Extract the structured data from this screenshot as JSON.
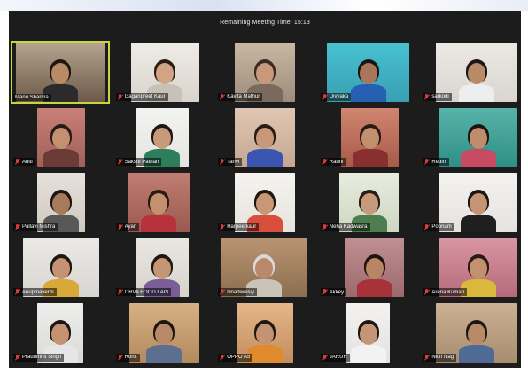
{
  "meeting": {
    "timer_text": "Remaining Meeting Time: 15:13"
  },
  "participants": [
    {
      "name": "Manu Sharma",
      "muted": false,
      "active": true,
      "bg": "#6d5a4a",
      "wall": "#b5a48f",
      "skin": "#b98a66",
      "hair": "#1e1612",
      "shirt": "#2b2b2b"
    },
    {
      "name": "Gaganpreet Kaur",
      "muted": true,
      "active": false,
      "bg": "#d9d3cc",
      "wall": "#efece7",
      "skin": "#d2a486",
      "hair": "#2a1c15",
      "shirt": "#c9c1b6"
    },
    {
      "name": "Kavita Mathur",
      "muted": true,
      "active": false,
      "bg": "#9c8c7a",
      "wall": "#c9b9a3",
      "skin": "#c8997a",
      "hair": "#3a2a22",
      "shirt": "#7a6a5e"
    },
    {
      "name": "Divyaka",
      "muted": true,
      "active": false,
      "bg": "#3a9fb3",
      "wall": "#48c1d1",
      "skin": "#a8765a",
      "hair": "#1c1410",
      "shirt": "#2660b3"
    },
    {
      "name": "sarkodi",
      "muted": true,
      "active": false,
      "bg": "#d9d5d0",
      "wall": "#ece9e4",
      "skin": "#b98a66",
      "hair": "#1e1612",
      "shirt": "#eeeeee"
    },
    {
      "name": "Aditi",
      "muted": true,
      "active": false,
      "bg": "#a0615a",
      "wall": "#c97f76",
      "skin": "#c39070",
      "hair": "#2a1a14",
      "shirt": "#6b3b38"
    },
    {
      "name": "Sakshi Pathan",
      "muted": true,
      "active": false,
      "bg": "#e4e4e0",
      "wall": "#f3f3f1",
      "skin": "#c79a7c",
      "hair": "#22170f",
      "shirt": "#2e7d5b"
    },
    {
      "name": "Tanvi",
      "muted": true,
      "active": false,
      "bg": "#c6a791",
      "wall": "#e0c7b3",
      "skin": "#c7987a",
      "hair": "#2a1c15",
      "shirt": "#3a56b0"
    },
    {
      "name": "Radni",
      "muted": true,
      "active": false,
      "bg": "#a85a4a",
      "wall": "#cf8570",
      "skin": "#c28f6f",
      "hair": "#2b1a12",
      "shirt": "#8a2f2f"
    },
    {
      "name": "Redini",
      "muted": true,
      "active": false,
      "bg": "#2f8f86",
      "wall": "#57b3a8",
      "skin": "#bf8c6c",
      "hair": "#1e1410",
      "shirt": "#c94a63"
    },
    {
      "name": "Pallavi Mishra",
      "muted": true,
      "active": false,
      "bg": "#cfc8c0",
      "wall": "#e6e1db",
      "skin": "#a87a5c",
      "hair": "#1e1612",
      "shirt": "#585858"
    },
    {
      "name": "Ayan",
      "muted": true,
      "active": false,
      "bg": "#9a5850",
      "wall": "#c07e72",
      "skin": "#c39070",
      "hair": "#2a1a14",
      "shirt": "#b8323c"
    },
    {
      "name": "Harpeetkaur",
      "muted": true,
      "active": false,
      "bg": "#e7e4df",
      "wall": "#f5f3ef",
      "skin": "#c79877",
      "hair": "#22170f",
      "shirt": "#d94f3d"
    },
    {
      "name": "Neha Kadwasra",
      "muted": true,
      "active": false,
      "bg": "#cfd6c2",
      "wall": "#e7ecde",
      "skin": "#c79a7c",
      "hair": "#2a1c15",
      "shirt": "#4d7f4e"
    },
    {
      "name": "Poonam",
      "muted": true,
      "active": false,
      "bg": "#e5e2df",
      "wall": "#f4f2ef",
      "skin": "#c49474",
      "hair": "#1e140f",
      "shirt": "#1f1f1f"
    },
    {
      "name": "Anupmaverm",
      "muted": true,
      "active": false,
      "bg": "#d8d6d2",
      "wall": "#ebe9e6",
      "skin": "#c39373",
      "hair": "#1f1610",
      "shirt": "#d9a83a"
    },
    {
      "name": "ORVA FOOD LAIS",
      "muted": true,
      "active": false,
      "bg": "#d6d2cc",
      "wall": "#eae7e3",
      "skin": "#c59676",
      "hair": "#22170f",
      "shirt": "#7b5e96"
    },
    {
      "name": "Dnadiwesiy",
      "muted": true,
      "active": false,
      "bg": "#8c6e50",
      "wall": "#b89472",
      "skin": "#b9886a",
      "hair": "#d9d9d9",
      "shirt": "#c9c3b8"
    },
    {
      "name": "Akkey",
      "muted": true,
      "active": false,
      "bg": "#9c6a6e",
      "wall": "#c08f92",
      "skin": "#b98564",
      "hair": "#1e1410",
      "shirt": "#a83239"
    },
    {
      "name": "Arena Kumari",
      "muted": true,
      "active": false,
      "bg": "#b56a7a",
      "wall": "#d896a2",
      "skin": "#c39070",
      "hair": "#2a1a14",
      "shirt": "#d9b83c"
    },
    {
      "name": "Pradumnit Singh",
      "muted": true,
      "active": false,
      "bg": "#d9d9d6",
      "wall": "#eeeeec",
      "skin": "#c39373",
      "hair": "#1e1612",
      "shirt": "#e6e6e6"
    },
    {
      "name": "Rohit",
      "muted": true,
      "active": false,
      "bg": "#b38a5e",
      "wall": "#d6b184",
      "skin": "#b98866",
      "hair": "#1e1410",
      "shirt": "#5c6f8f"
    },
    {
      "name": "OPPO A5",
      "muted": true,
      "active": false,
      "bg": "#c48e5e",
      "wall": "#e3b68a",
      "skin": "#c39373",
      "hair": "#22170f",
      "shirt": "#e08a2e"
    },
    {
      "name": "JARUR",
      "muted": true,
      "active": false,
      "bg": "#e3e2e0",
      "wall": "#f3f2f0",
      "skin": "#c59676",
      "hair": "#1f1610",
      "shirt": "#f2f2f2"
    },
    {
      "name": "Nitin Nag",
      "muted": true,
      "active": false,
      "bg": "#a78c6f",
      "wall": "#ccb193",
      "skin": "#b98a66",
      "hair": "#1e1612",
      "shirt": "#4f6a95"
    }
  ]
}
